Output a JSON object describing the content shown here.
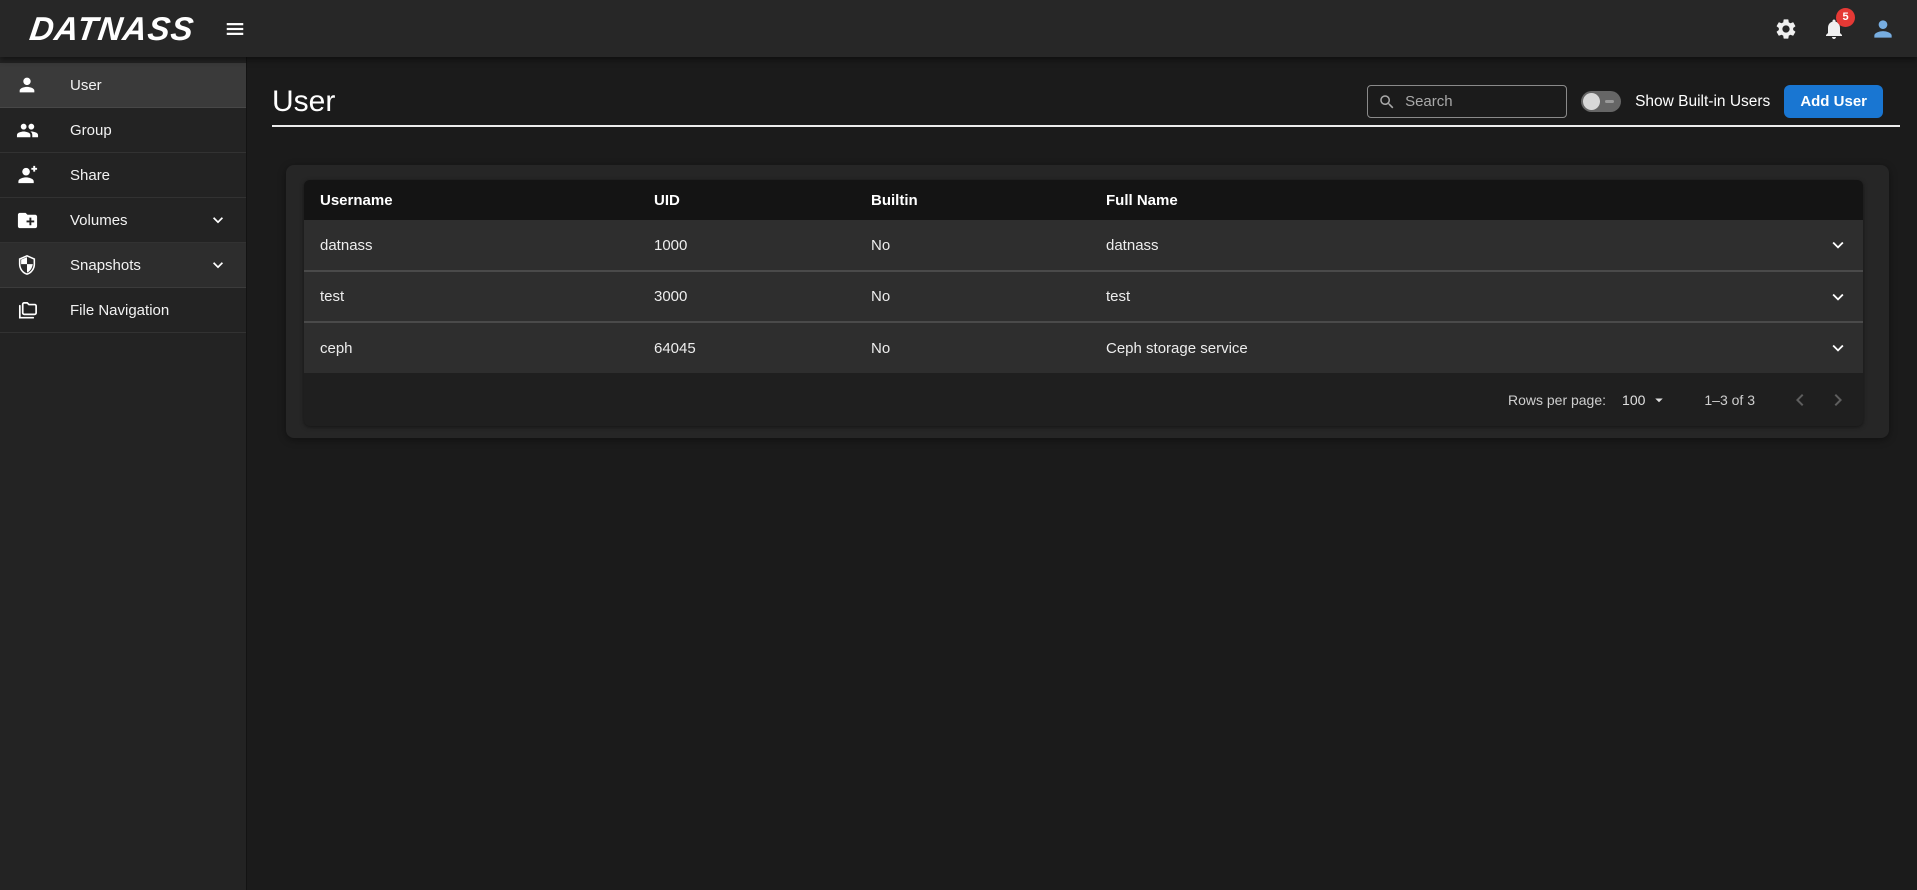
{
  "topbar": {
    "logo": "DATNASS",
    "notification_count": "5",
    "icons": [
      "menu-icon",
      "settings-icon",
      "notifications-icon",
      "user-avatar-icon"
    ]
  },
  "sidebar": {
    "items": [
      {
        "label": "User",
        "icon": "person-icon",
        "active": true,
        "expandable": false
      },
      {
        "label": "Group",
        "icon": "group-icon",
        "active": false,
        "expandable": false
      },
      {
        "label": "Share",
        "icon": "person-add-icon",
        "active": false,
        "expandable": false
      },
      {
        "label": "Volumes",
        "icon": "folder-plus-icon",
        "active": false,
        "expandable": true
      },
      {
        "label": "Snapshots",
        "icon": "shield-icon",
        "active": false,
        "expandable": true
      },
      {
        "label": "File Navigation",
        "icon": "folders-icon",
        "active": false,
        "expandable": false
      }
    ]
  },
  "page": {
    "title": "User",
    "search": {
      "placeholder": "Search",
      "value": ""
    },
    "toggle": {
      "label": "Show Built-in Users",
      "on": false
    },
    "add_button_label": "Add User"
  },
  "table": {
    "columns": [
      "Username",
      "UID",
      "Builtin",
      "Full Name"
    ],
    "rows": [
      {
        "username": "datnass",
        "uid": "1000",
        "builtin": "No",
        "full_name": "datnass"
      },
      {
        "username": "test",
        "uid": "3000",
        "builtin": "No",
        "full_name": "test"
      },
      {
        "username": "ceph",
        "uid": "64045",
        "builtin": "No",
        "full_name": "Ceph storage service"
      }
    ]
  },
  "pagination": {
    "rows_per_page_label": "Rows per page:",
    "rows_per_page_value": "100",
    "range_label": "1–3 of 3"
  },
  "colors": {
    "accent-blue": "#1976d2",
    "badge-red": "#e53935",
    "avatar-blue": "#77ade0"
  }
}
